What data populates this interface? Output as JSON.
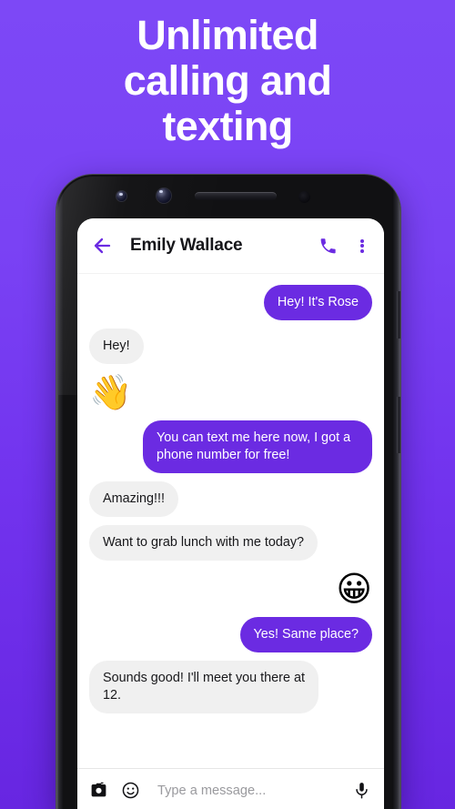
{
  "promo": {
    "headline_lines": [
      "Unlimited",
      "calling and",
      "texting"
    ],
    "background_color_top": "#7D48F6",
    "background_color_bottom": "#6726E1"
  },
  "app": {
    "accent_color": "#6B2BE2",
    "header": {
      "back_icon": "back-arrow-icon",
      "contact_name": "Emily Wallace",
      "call_icon": "phone-call-icon",
      "menu_icon": "overflow-menu-icon"
    },
    "messages": [
      {
        "direction": "out",
        "type": "text",
        "text": "Hey! It's Rose"
      },
      {
        "direction": "in",
        "type": "text",
        "text": "Hey!"
      },
      {
        "direction": "in",
        "type": "emoji",
        "text": "👋",
        "emoji_name": "waving-hand-emoji"
      },
      {
        "direction": "out",
        "type": "text",
        "text": "You can text me here now, I got a phone number for free!"
      },
      {
        "direction": "in",
        "type": "text",
        "text": "Amazing!!!"
      },
      {
        "direction": "in",
        "type": "text",
        "text": "Want to grab lunch with me today?"
      },
      {
        "direction": "out",
        "type": "emoji",
        "text": "😀",
        "emoji_name": "grinning-face-emoji"
      },
      {
        "direction": "out",
        "type": "text",
        "text": "Yes! Same place?"
      },
      {
        "direction": "in",
        "type": "text",
        "text": "Sounds good! I'll meet you there at 12."
      }
    ],
    "composer": {
      "camera_icon": "camera-icon",
      "emoji_icon": "emoji-smiley-icon",
      "placeholder": "Type a message...",
      "mic_icon": "microphone-icon"
    }
  }
}
